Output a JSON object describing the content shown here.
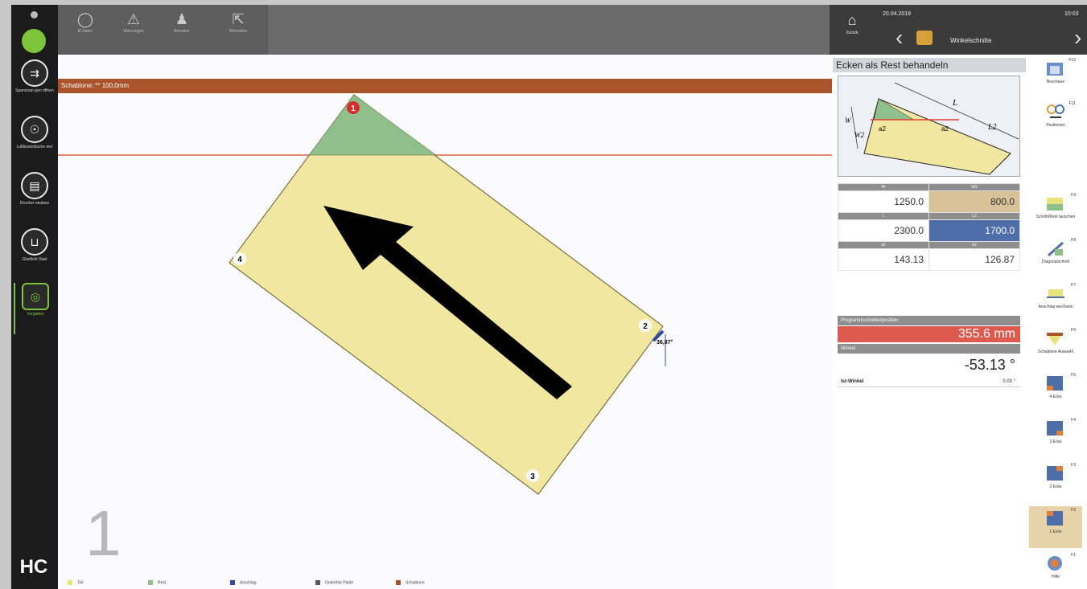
{
  "topbar": {
    "buttons": [
      {
        "label": "Ø Daten",
        "icon": "circle-icon"
      },
      {
        "label": "Warnungen",
        "icon": "warning-icon"
      },
      {
        "label": "Benutzer",
        "icon": "user-icon"
      },
      {
        "label": "Abmelden",
        "icon": "logout-icon"
      }
    ],
    "home_label": "Zurück",
    "date": "20.04.2019",
    "time": "10:03",
    "screen_title": "Winkelschnitte"
  },
  "sidebar": {
    "items": [
      {
        "label": "Spannzan-gen öffnen",
        "icon": "clamp-icon"
      },
      {
        "label": "Luftkissentische ein/",
        "icon": "air-table-icon"
      },
      {
        "label": "Drucker neulass",
        "icon": "printer-icon"
      },
      {
        "label": "Gleitlicht Start",
        "icon": "light-icon"
      },
      {
        "label": "Vorgaben",
        "icon": "settings-icon"
      }
    ],
    "logo": "HC"
  },
  "canvas": {
    "template_label": "Schablone: ** 100,0mm",
    "corner_labels": [
      "1",
      "2",
      "3",
      "4"
    ],
    "angle_label": "36,87°",
    "big_number": "1"
  },
  "panel": {
    "title": "Ecken als Rest behandeln",
    "diagram_labels": {
      "L": "L",
      "L2": "L2",
      "W": "W",
      "W2": "W2",
      "a2_left": "a2",
      "a2_right": "a2"
    },
    "table": {
      "headers": [
        [
          "W",
          "W2"
        ],
        [
          "L",
          "L2"
        ],
        [
          "a2",
          "b2"
        ]
      ],
      "values": [
        [
          "1250.0",
          "800.0"
        ],
        [
          "2300.0",
          "1700.0"
        ],
        [
          "143.13",
          "126.87"
        ]
      ]
    },
    "position_label": "Programmschieberposition",
    "position_value": "355.6 mm",
    "angle_label": "Winkel",
    "angle_value": "-53.13 °",
    "ist_label": "Ist-Winkel",
    "ist_value": "0.00 °"
  },
  "fkeys": [
    {
      "label": "Beschaue",
      "key": "F12"
    },
    {
      "label": "Positionen",
      "key": "F11"
    },
    {
      "label": "Schnitt/Rest tauschen",
      "key": "F9"
    },
    {
      "label": "Diagonalschnitt",
      "key": "F8"
    },
    {
      "label": "Anschlag wechseln",
      "key": "F7"
    },
    {
      "label": "Schablone Auswahl",
      "key": "F6"
    },
    {
      "label": "4 Ecke",
      "key": "F5"
    },
    {
      "label": "3 Ecke",
      "key": "F4"
    },
    {
      "label": "2 Ecke",
      "key": "F3"
    },
    {
      "label": "1 Ecke",
      "key": "F2"
    },
    {
      "label": "Hilfe",
      "key": "F1"
    }
  ],
  "legend": [
    {
      "label": "Teil",
      "color": "#e8e37a"
    },
    {
      "label": "Rest",
      "color": "#8fbf8a"
    },
    {
      "label": "Anschlag",
      "color": "#3048a8"
    },
    {
      "label": "Gedrehte Platte",
      "color": "#5a5a5a"
    },
    {
      "label": "Schablone",
      "color": "#a9542a"
    }
  ]
}
